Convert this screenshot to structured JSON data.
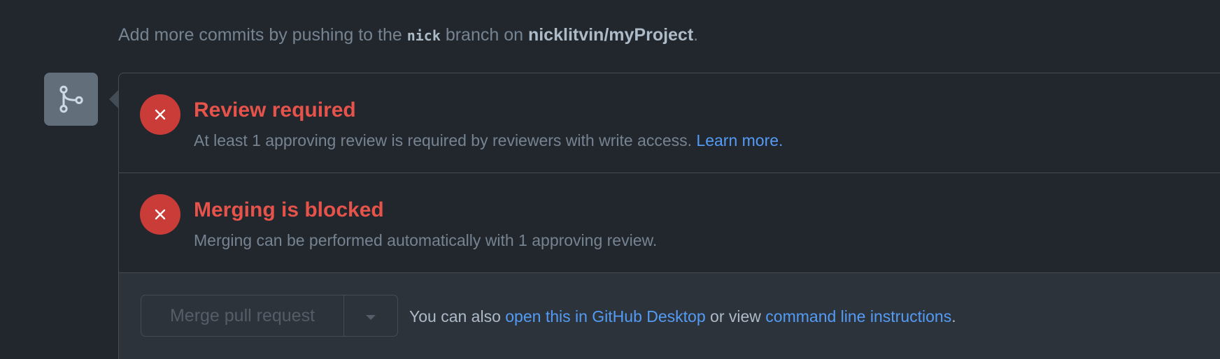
{
  "hint": {
    "prefix": "Add more commits by pushing to the ",
    "branch": "nick",
    "middle": " branch on ",
    "repo": "nicklitvin/myProject",
    "suffix": "."
  },
  "checks": [
    {
      "title": "Review required",
      "description": "At least 1 approving review is required by reviewers with write access. ",
      "link": "Learn more."
    },
    {
      "title": "Merging is blocked",
      "description": "Merging can be performed automatically with 1 approving review."
    }
  ],
  "actions": {
    "merge_button_label": "Merge pull request",
    "alt_prefix": "You can also ",
    "desktop_link": "open this in GitHub Desktop",
    "alt_middle": " or view ",
    "cli_link": "command line instructions",
    "alt_suffix": "."
  },
  "colors": {
    "background": "#22272e",
    "error": "#e5534b",
    "error_circle": "#c93c37",
    "link": "#539bf5",
    "muted": "#768390"
  },
  "icons": {
    "merge_avatar": "git-merge-icon",
    "check_status": "x-icon",
    "dropdown": "triangle-down-icon"
  }
}
